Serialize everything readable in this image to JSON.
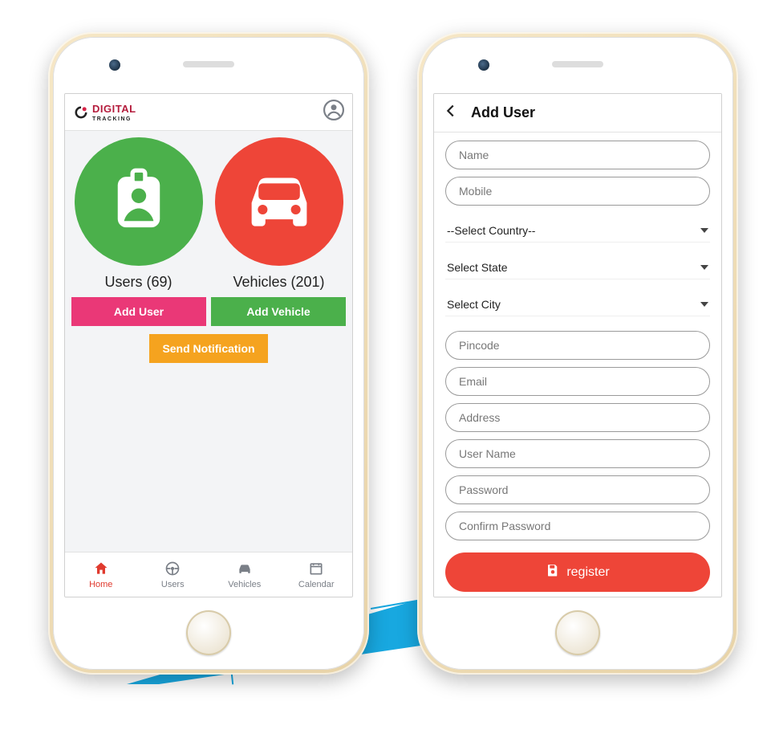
{
  "colors": {
    "green": "#4bb04b",
    "red": "#ee4538",
    "pink": "#ea3877",
    "orange": "#f5a31f",
    "annotation_blue": "#18a8e0"
  },
  "phone1": {
    "header": {
      "logo_top": "DIGITAL",
      "logo_sub": "TRACKING"
    },
    "dashboard": {
      "users": {
        "label": "Users (69)",
        "button": "Add User"
      },
      "vehicles": {
        "label": "Vehicles (201)",
        "button": "Add Vehicle"
      },
      "send_notification": "Send Notification"
    },
    "nav": {
      "home": "Home",
      "users": "Users",
      "vehicles": "Vehicles",
      "calendar": "Calendar"
    }
  },
  "phone2": {
    "header": {
      "title": "Add User"
    },
    "form": {
      "name": "Name",
      "mobile": "Mobile",
      "select_country": "--Select Country--",
      "select_state": "Select State",
      "select_city": "Select City",
      "pincode": "Pincode",
      "email": "Email",
      "address": "Address",
      "username": "User Name",
      "password": "Password",
      "confirm_password": "Confirm Password",
      "register": "register"
    }
  }
}
